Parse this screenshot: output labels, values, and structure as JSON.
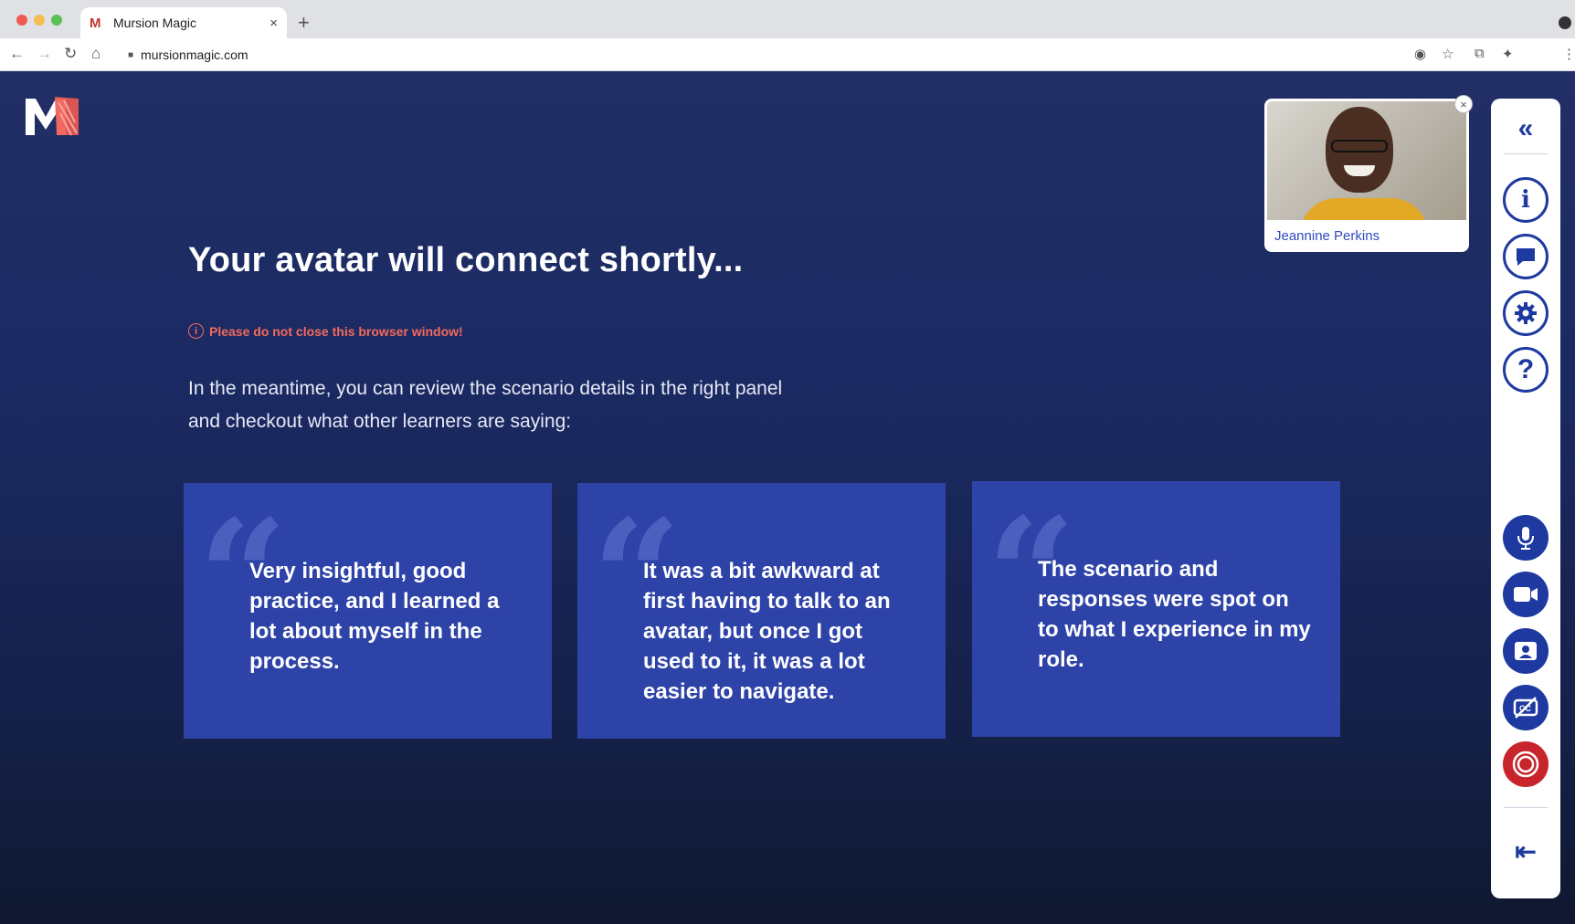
{
  "browser": {
    "tab_title": "Mursion Magic",
    "tab_favicon": "M",
    "tab_close": "×",
    "new_tab": "+",
    "url": "mursionmagic.com"
  },
  "main": {
    "headline": "Your avatar will connect shortly...",
    "warning_icon": "i",
    "warning": "Please do not close this browser window!",
    "intro": "In the meantime, you can review the scenario details in the right panel and checkout what other learners are saying:",
    "quote_mark": "“",
    "testimonials": [
      {
        "text": "Very insightful, good practice, and I learned a lot about myself in the process."
      },
      {
        "text": "It was a bit awkward at first having to talk to an avatar, but once I got used to it, it was a lot easier to navigate."
      },
      {
        "text": "The scenario and responses were spot on to what I experience in my role."
      }
    ]
  },
  "preview": {
    "name": "Jeannine Perkins",
    "close": "×"
  },
  "panel": {
    "collapse": "«",
    "info": "i",
    "help": "?",
    "exit": "⇤"
  },
  "colors": {
    "accent": "#1e3aa0",
    "card": "#2e43a8",
    "warning": "#f26a5c",
    "record": "#c8242c"
  }
}
